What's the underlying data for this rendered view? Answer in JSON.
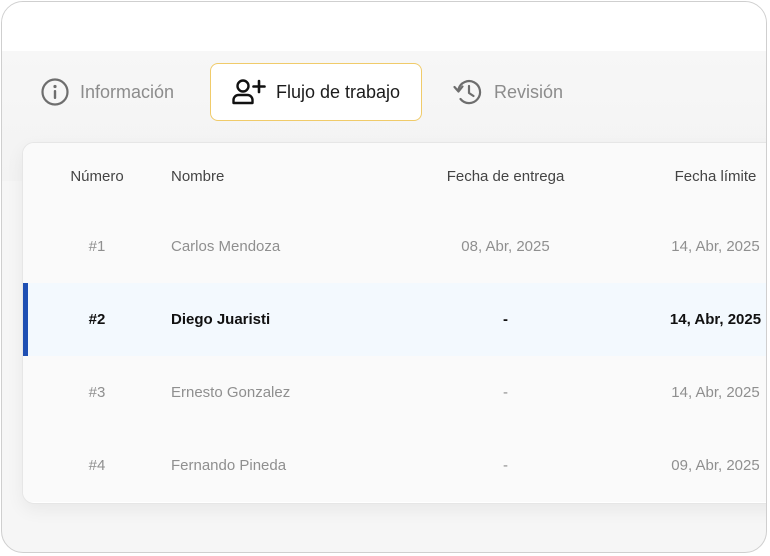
{
  "tabs": [
    {
      "label": "Información",
      "icon": "info-icon",
      "active": false
    },
    {
      "label": "Flujo de trabajo",
      "icon": "add-user-icon",
      "active": true
    },
    {
      "label": "Revisión",
      "icon": "history-icon",
      "active": false
    }
  ],
  "colors": {
    "accent_border": "#f0cb6a",
    "selected_row_bg": "#f3f9fe",
    "selected_marker": "#1f4fb3"
  },
  "table": {
    "columns": [
      "Número",
      "Nombre",
      "Fecha de entrega",
      "Fecha límite"
    ],
    "rows": [
      {
        "numero": "#1",
        "nombre": "Carlos Mendoza",
        "entrega": "08, Abr, 2025",
        "limite": "14, Abr, 2025",
        "selected": false
      },
      {
        "numero": "#2",
        "nombre": "Diego Juaristi",
        "entrega": "-",
        "limite": "14, Abr, 2025",
        "selected": true
      },
      {
        "numero": "#3",
        "nombre": "Ernesto Gonzalez",
        "entrega": "-",
        "limite": "14, Abr, 2025",
        "selected": false
      },
      {
        "numero": "#4",
        "nombre": "Fernando Pineda",
        "entrega": "-",
        "limite": "09, Abr, 2025",
        "selected": false
      }
    ]
  }
}
